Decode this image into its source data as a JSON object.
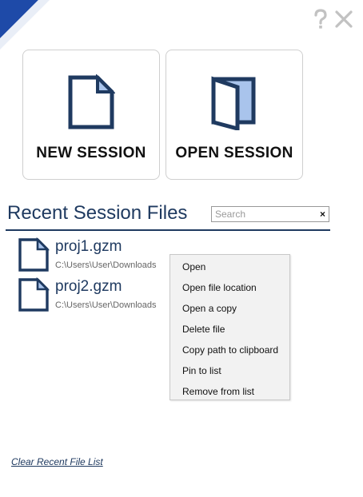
{
  "colors": {
    "accent": "#1f3a60",
    "corner": "#1e4aa8",
    "icon_fill": "#a9c4ec",
    "menu_bg": "#f2f2f2"
  },
  "header": {
    "help_icon": "question-mark-icon",
    "close_icon": "close-icon"
  },
  "tiles": {
    "new_session": {
      "label": "NEW SESSION",
      "icon": "new-document-icon"
    },
    "open_session": {
      "label": "OPEN SESSION",
      "icon": "open-book-icon"
    }
  },
  "recent": {
    "title": "Recent Session Files",
    "search": {
      "placeholder": "Search",
      "value": "",
      "clear_glyph": "×"
    },
    "files": [
      {
        "name": "proj1.gzm",
        "path": "C:\\Users\\User\\Downloads",
        "icon": "file-icon"
      },
      {
        "name": "proj2.gzm",
        "path": "C:\\Users\\User\\Downloads",
        "icon": "file-icon"
      }
    ],
    "clear_link": "Clear Recent File List"
  },
  "context_menu": {
    "items": [
      {
        "label": "Open"
      },
      {
        "label": "Open file location"
      },
      {
        "label": "Open a copy"
      },
      {
        "label": "Delete file"
      },
      {
        "label": "Copy path to clipboard"
      },
      {
        "label": "Pin to list"
      },
      {
        "label": "Remove from list"
      }
    ]
  }
}
